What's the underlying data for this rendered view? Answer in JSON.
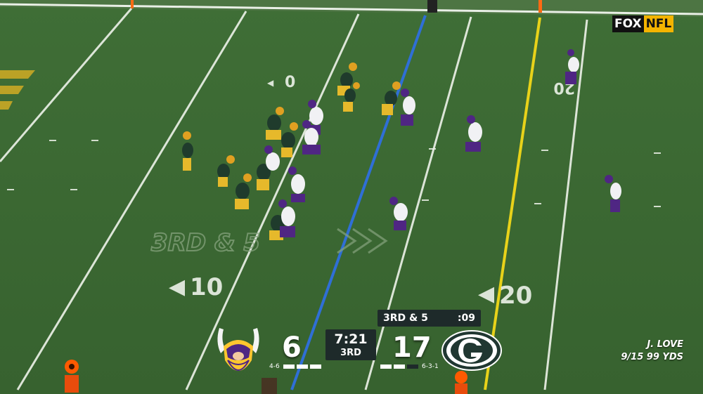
{
  "broadcast": {
    "network": "FOX",
    "league": "NFL"
  },
  "field": {
    "yard_numbers_left": [
      "0",
      "10"
    ],
    "yard_numbers_right": [
      "20",
      "20"
    ],
    "down_marker_text": "3RD & 5",
    "colors": {
      "grass": "#3d6b35",
      "line_of_scrimmage": "#2f6fd6",
      "first_down": "#e8d21a"
    }
  },
  "scorebug": {
    "down_distance": "3RD & 5",
    "play_clock": ":09",
    "game_clock": "7:21",
    "quarter": "3RD",
    "away": {
      "name": "Vikings",
      "score": "6",
      "record": "4-6",
      "logo": "vikings-logo",
      "color": "#4f2683"
    },
    "home": {
      "name": "Packers",
      "score": "17",
      "record": "6-3-1",
      "logo": "packers-logo",
      "color": "#203731"
    }
  },
  "player_stat": {
    "name": "J. LOVE",
    "line": "9/15  99 YDS"
  }
}
